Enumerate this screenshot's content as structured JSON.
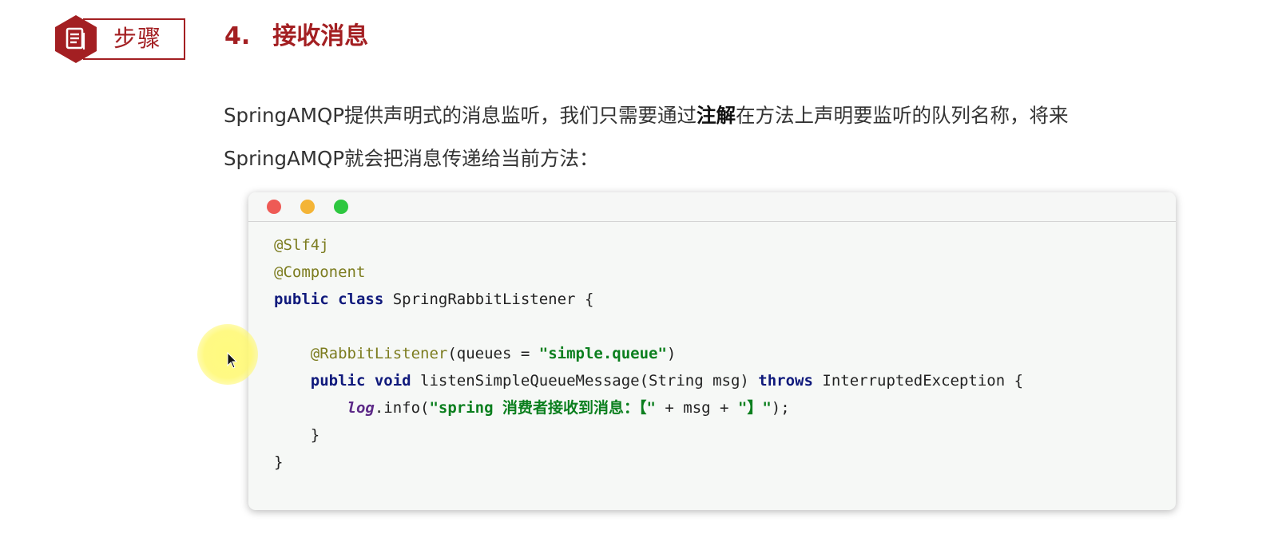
{
  "header": {
    "badge_label": "步骤",
    "section_number": "4.",
    "section_title": "接收消息"
  },
  "intro": {
    "part1": "SpringAMQP提供声明式的消息监听，我们只需要通过",
    "bold": "注解",
    "part2": "在方法上声明要监听的队列名称，将来",
    "line2": "SpringAMQP就会把消息传递给当前方法："
  },
  "code": {
    "l1_annotation": "@Slf4j",
    "l2_annotation": "@Component",
    "l3_kw": "public class",
    "l3_rest": " SpringRabbitListener {",
    "l5_annotation": "@RabbitListener",
    "l5_mid": "(queues = ",
    "l5_string": "\"simple.queue\"",
    "l5_end": ")",
    "l6_kw": "public void",
    "l6_mid": " listenSimpleQueueMessage(String msg) ",
    "l6_throws": "throws",
    "l6_end": " InterruptedException {",
    "l7_log": "log",
    "l7_mid": ".info(",
    "l7_string1": "\"spring 消费者接收到消息：【\"",
    "l7_concat": " + msg + ",
    "l7_string2": "\"】\"",
    "l7_end": ");",
    "l8": "}",
    "l9": "}"
  },
  "colors": {
    "brand_red": "#a31f22",
    "annotation": "#7c7c1f",
    "keyword": "#101a7c",
    "string": "#0b7f1e"
  }
}
